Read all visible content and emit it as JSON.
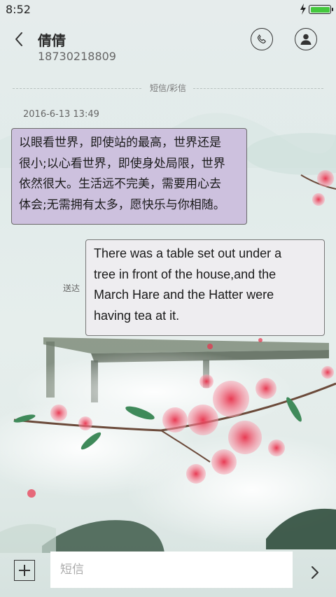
{
  "status_bar": {
    "time": "8:52",
    "battery_color": "#44c83d"
  },
  "header": {
    "contact_name": "倩倩",
    "contact_phone": "18730218809",
    "icons": [
      "back-icon",
      "phone-icon",
      "person-icon"
    ]
  },
  "thread": {
    "divider_label": "短信/彩信",
    "timestamp": "2016-6-13 13:49",
    "messages": [
      {
        "direction": "incoming",
        "lines": [
          "以眼看世界，即使站的最高，世界还是",
          "很小;以心看世界，即使身处局限，世界",
          "依然很大。生活远不完美，需要用心去",
          "体会;无需拥有太多，愿快乐与你相随。"
        ],
        "bubble_color": "#cdc1de"
      },
      {
        "direction": "outgoing",
        "status": "送达",
        "lines": [
          "There was a table set out under a",
          "tree in front of the house,and the",
          "March Hare and the Hatter were",
          "having tea at it."
        ],
        "bubble_color": "#eeedf0"
      }
    ]
  },
  "composer": {
    "placeholder": "短信",
    "value": "",
    "icons": [
      "add-icon",
      "send-icon"
    ]
  }
}
